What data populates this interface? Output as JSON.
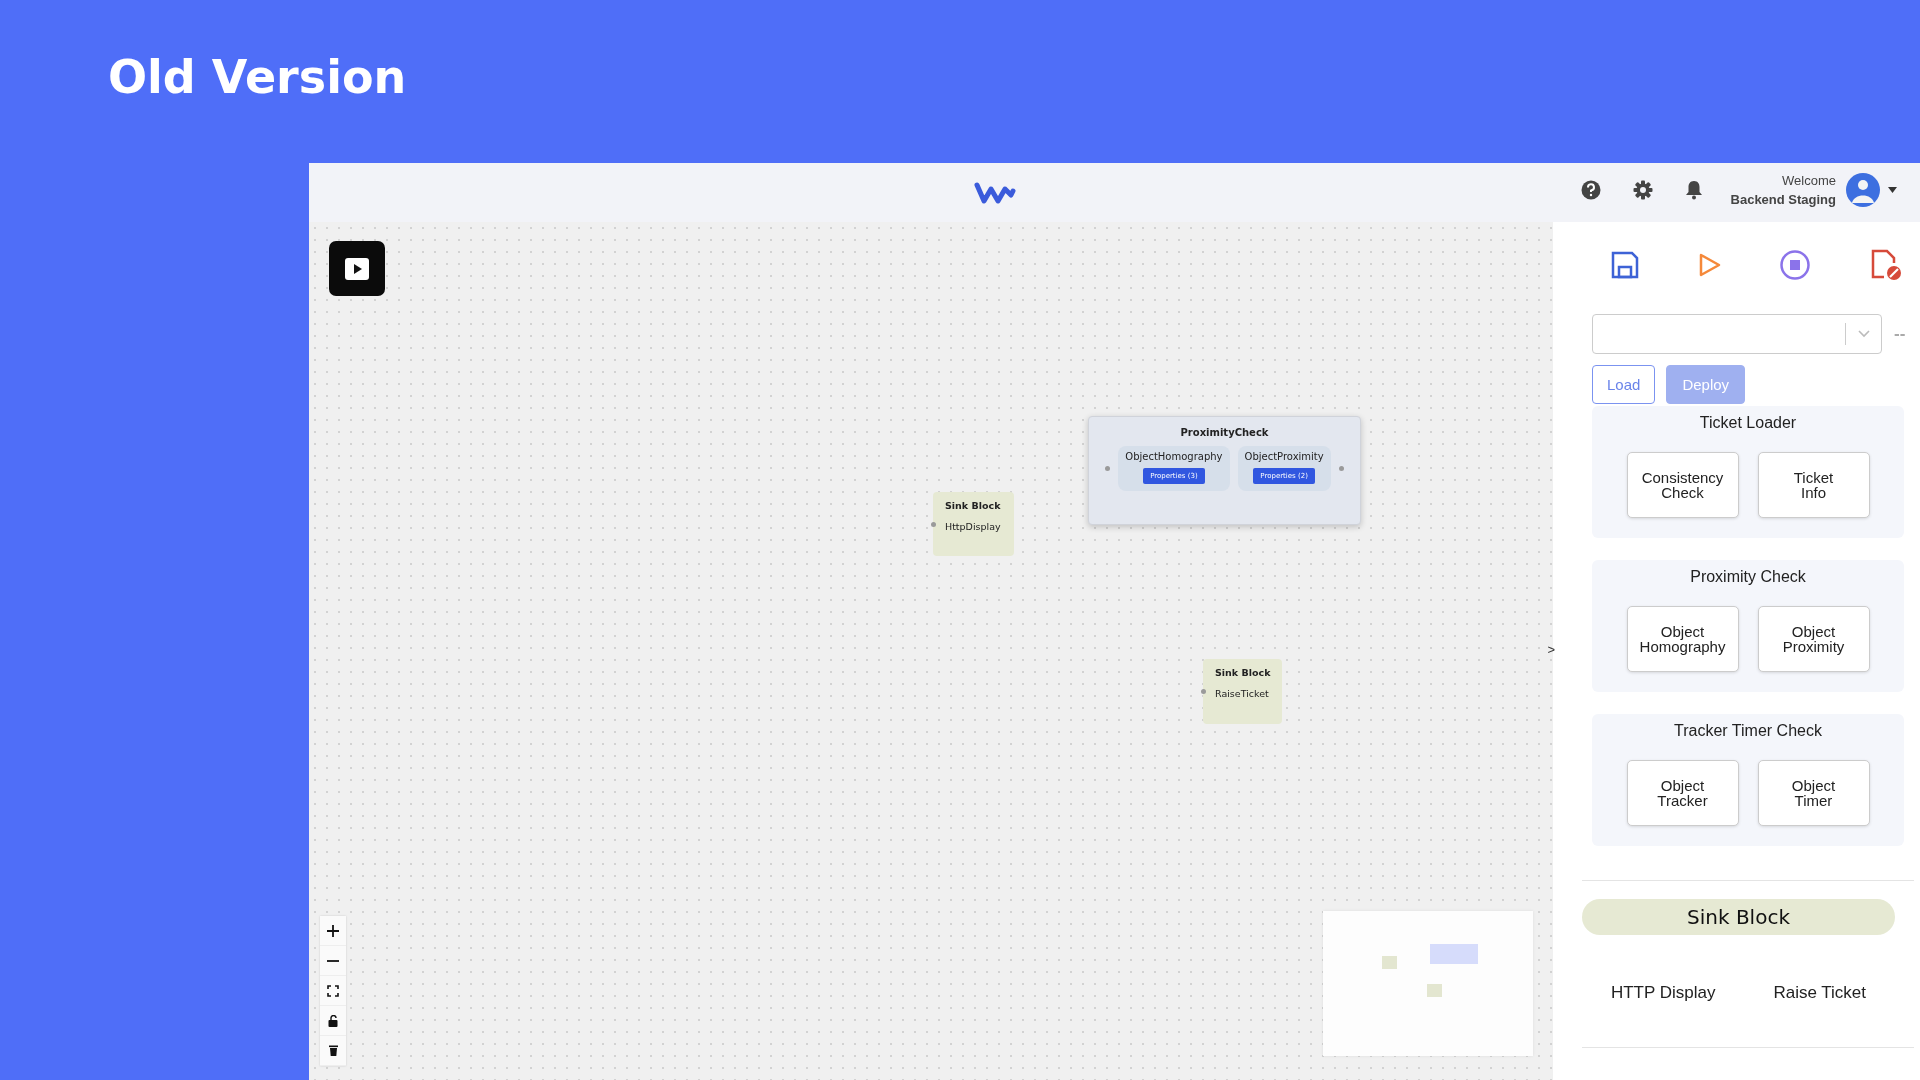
{
  "heading": "Old Version",
  "header": {
    "welcome": "Welcome",
    "user": "Backend Staging"
  },
  "select": {
    "extra": "--"
  },
  "actions": [
    {
      "label": "Load",
      "disabled": false
    },
    {
      "label": "Deploy",
      "disabled": true
    }
  ],
  "collapse_toggle": ">",
  "groups": [
    {
      "title": "Ticket Loader",
      "blocks": [
        "Consistency Check",
        "Ticket Info"
      ]
    },
    {
      "title": "Proximity Check",
      "blocks": [
        "Object Homography",
        "Object Proximity"
      ]
    },
    {
      "title": "Tracker Timer Check",
      "blocks": [
        "Object Tracker",
        "Object Timer"
      ]
    }
  ],
  "sink": {
    "title": "Sink Block",
    "blocks": [
      "HTTP Display",
      "Raise Ticket"
    ]
  },
  "canvas": {
    "groups": [
      {
        "title": "ProximityCheck",
        "blocks": [
          {
            "name": "ObjectHomography",
            "properties": "Properties (3)"
          },
          {
            "name": "ObjectProximity",
            "properties": "Properties (2)"
          }
        ]
      }
    ],
    "sinks": [
      {
        "title": "Sink Block",
        "name": "HttpDisplay"
      },
      {
        "title": "Sink Block",
        "name": "RaiseTicket"
      }
    ]
  }
}
